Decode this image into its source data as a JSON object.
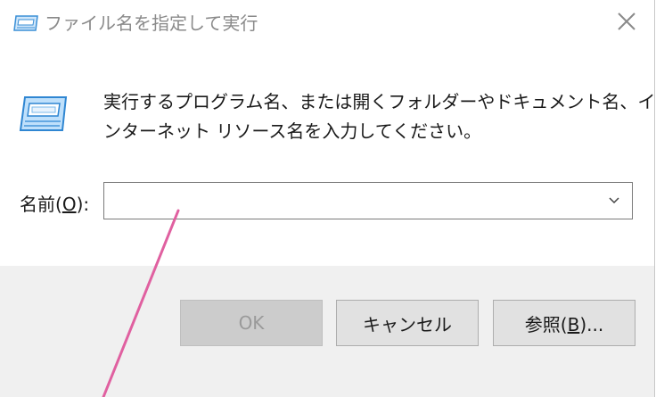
{
  "window": {
    "title": "ファイル名を指定して実行"
  },
  "content": {
    "description_line1": "実行するプログラム名、または開くフォルダーやドキュメント名、イ",
    "description_line2": "ンターネット リソース名を入力してください。",
    "name_label_prefix": "名前(",
    "name_label_accel": "O",
    "name_label_suffix": "):",
    "name_input_value": ""
  },
  "buttons": {
    "ok_label": "OK",
    "cancel_label": "キャンセル",
    "browse_prefix": "参照(",
    "browse_accel": "B",
    "browse_suffix": ")..."
  },
  "colors": {
    "annotation_line": "#e060a0",
    "icon_blue": "#3a8fd6",
    "footer_bg": "#f0f0f0"
  },
  "icons": {
    "title": "run-dialog-icon",
    "large": "run-dialog-icon",
    "close": "close-icon",
    "dropdown": "chevron-down-icon"
  }
}
